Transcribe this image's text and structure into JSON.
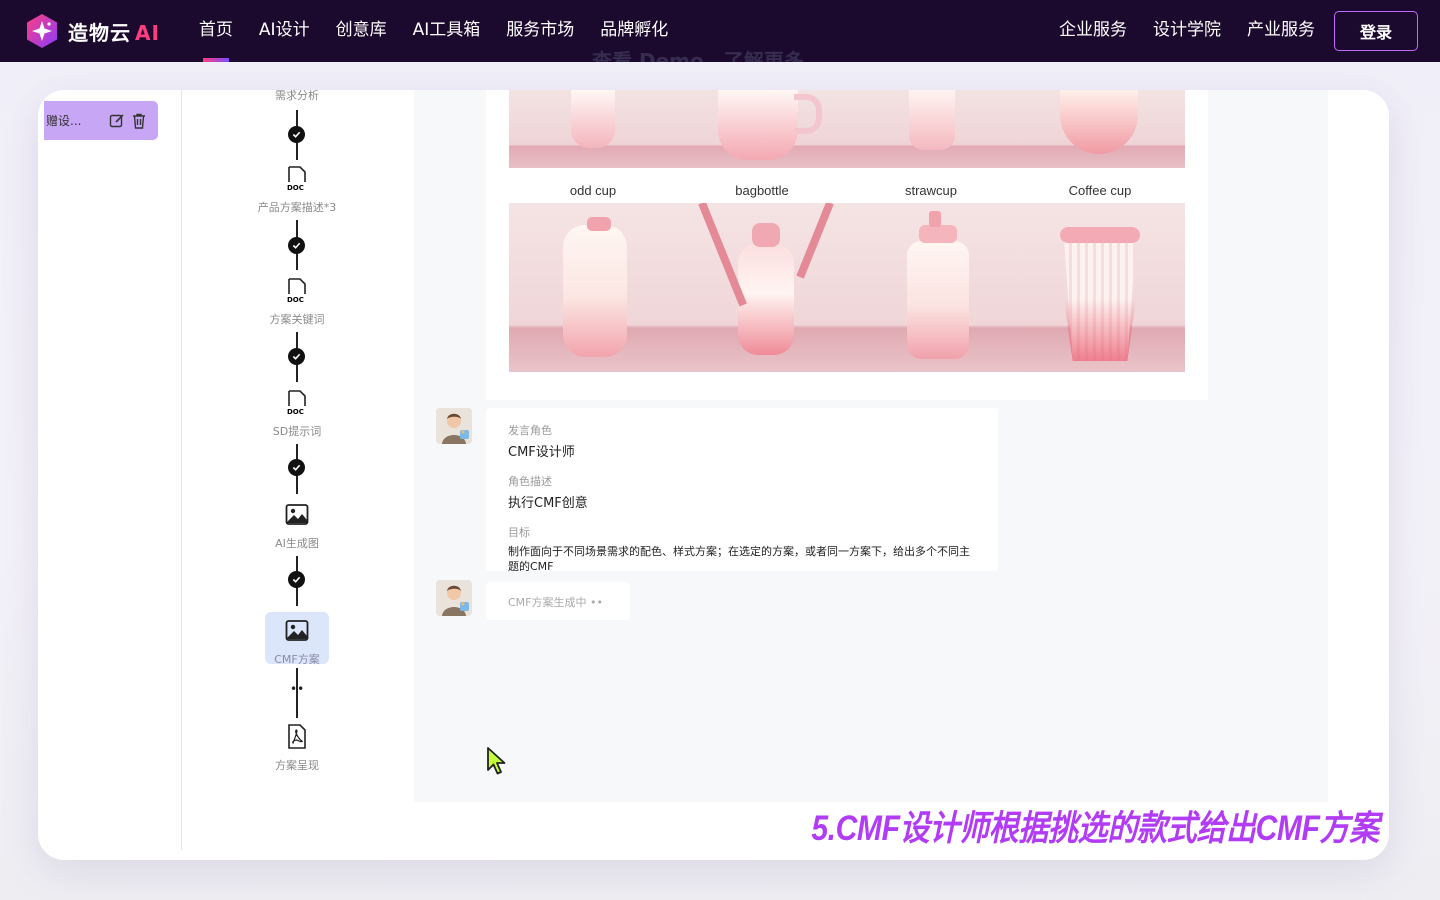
{
  "brand": {
    "name": "造物云",
    "suffix": "AI"
  },
  "nav": {
    "left": [
      "首页",
      "AI设计",
      "创意库",
      "AI工具箱",
      "服务市场",
      "品牌孵化"
    ],
    "right": [
      "企业服务",
      "设计学院",
      "产业服务"
    ],
    "login": "登录",
    "active_index": 0
  },
  "peek_text": "查看 Demo，了解更多",
  "sidebar": {
    "session_label": "赠设..."
  },
  "flow": {
    "top_partial_label": "需求分析",
    "nodes": [
      {
        "label": "产品方案描述*3",
        "icon": "doc-icon"
      },
      {
        "label": "方案关键词",
        "icon": "doc-icon"
      },
      {
        "label": "SD提示词",
        "icon": "doc-icon"
      },
      {
        "label": "AI生成图",
        "icon": "image-icon"
      },
      {
        "label": "CMF方案",
        "icon": "image-icon",
        "active": true
      },
      {
        "label": "方案呈现",
        "icon": "pdf-icon"
      }
    ],
    "pending_dots": "••"
  },
  "gallery": {
    "captions": [
      "odd cup",
      "bagbottle",
      "strawcup",
      "Coffee cup"
    ]
  },
  "messages": [
    {
      "role_label": "发言角色",
      "role": "CMF设计师",
      "desc_label": "角色描述",
      "desc": "执行CMF创意",
      "goal_label": "目标",
      "goal": "制作面向于不同场景需求的配色、样式方案；在选定的方案，或者同一方案下，给出多个不同主题的CMF"
    },
    {
      "status": "CMF方案生成中 ••"
    }
  ],
  "subtitle": "5.CMF设计师根据挑选的款式给出CMF方案",
  "colors": {
    "accent": "#b23cf5",
    "nav_bg": "#1c0a2e",
    "session_bg": "#c8a6f6"
  }
}
